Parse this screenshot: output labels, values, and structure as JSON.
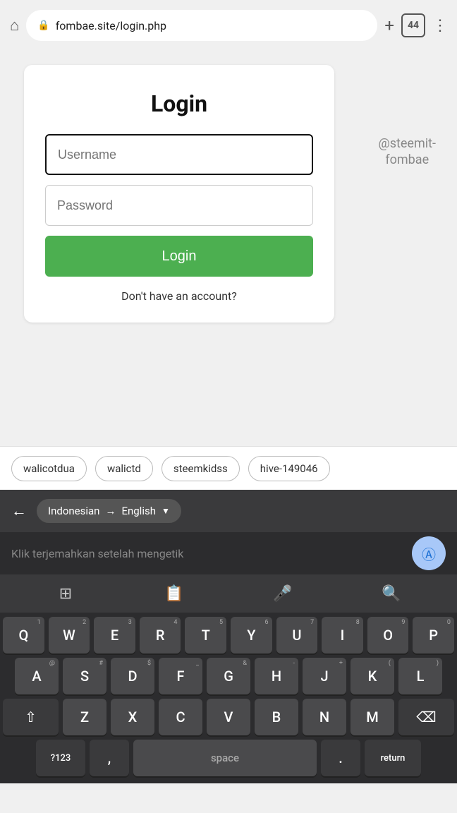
{
  "browser": {
    "url": "fombae.site/login.php",
    "tab_count": "44"
  },
  "login": {
    "title": "Login",
    "username_placeholder": "Username",
    "password_placeholder": "Password",
    "button_label": "Login",
    "no_account_text": "Don't have an account?",
    "steemit_label": "@steemit-\nfombae"
  },
  "suggestions": [
    "walicotdua",
    "walictd",
    "steemkidss",
    "hive-149046"
  ],
  "translation": {
    "from_lang": "Indonesian",
    "arrow": "→",
    "to_lang": "English",
    "placeholder": "Klik terjemahkan setelah mengetik"
  },
  "keyboard": {
    "rows": [
      [
        "Q",
        "W",
        "E",
        "R",
        "T",
        "Y",
        "U",
        "I",
        "O",
        "P"
      ],
      [
        "A",
        "S",
        "D",
        "F",
        "G",
        "H",
        "J",
        "K",
        "L"
      ],
      [
        "Z",
        "X",
        "C",
        "V",
        "B",
        "N",
        "M"
      ]
    ],
    "numbers": [
      "1",
      "2",
      "3",
      "4",
      "5",
      "6",
      "7",
      "8",
      "9",
      "0"
    ]
  }
}
